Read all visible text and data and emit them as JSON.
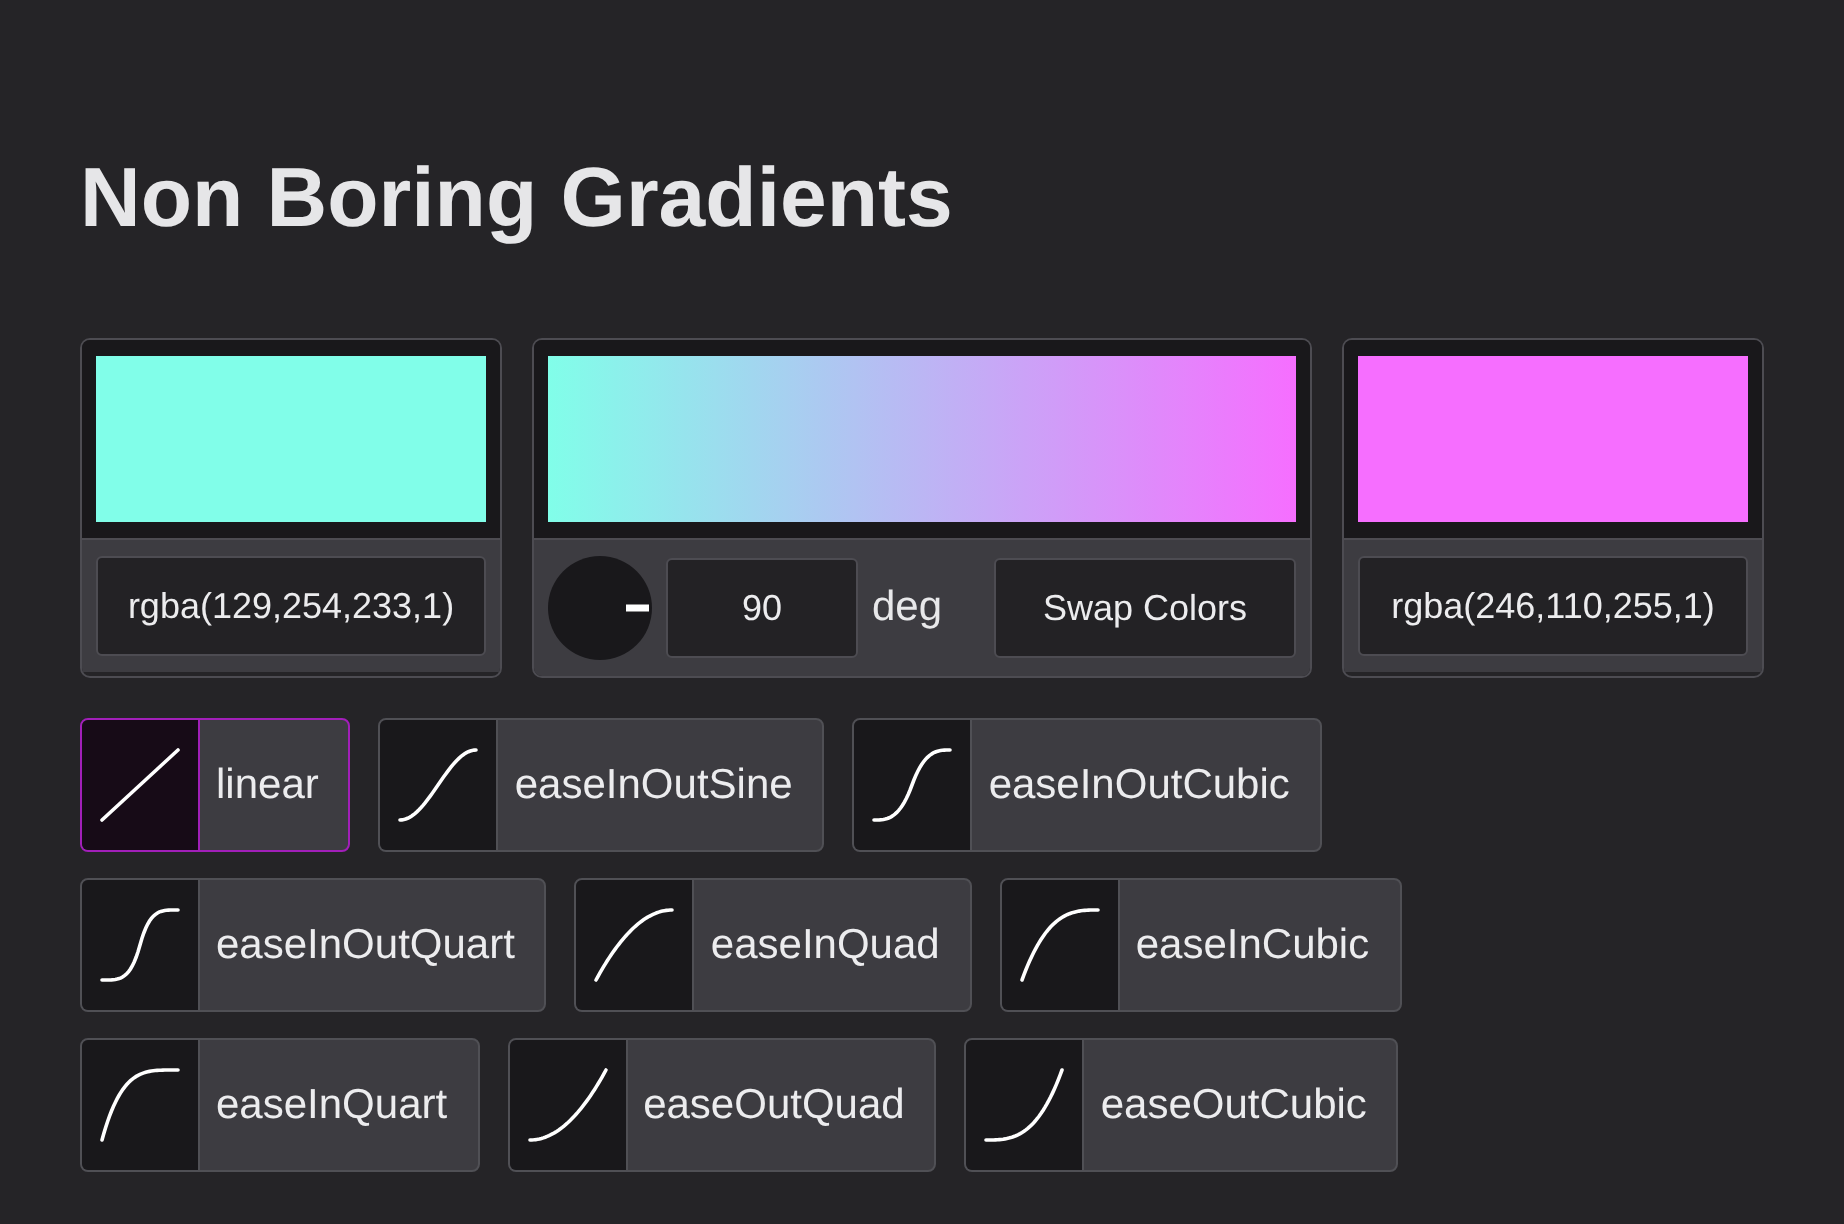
{
  "title": "Non Boring Gradients",
  "stops": [
    {
      "value": "rgba(129,254,233,1)",
      "color": "#81fee9"
    },
    {
      "value": "rgba(246,110,255,1)",
      "color": "#f66eff"
    }
  ],
  "angle": {
    "value": "90",
    "unit": "deg"
  },
  "swap_button": "Swap Colors",
  "easings": [
    {
      "label": "linear",
      "kind": "linear",
      "selected": true
    },
    {
      "label": "easeInOutSine",
      "kind": "inOutSine",
      "selected": false
    },
    {
      "label": "easeInOutCubic",
      "kind": "inOutCubic",
      "selected": false
    },
    {
      "label": "easeInOutQuart",
      "kind": "inOutQuart",
      "selected": false
    },
    {
      "label": "easeInQuad",
      "kind": "inQuad",
      "selected": false
    },
    {
      "label": "easeInCubic",
      "kind": "inCubic",
      "selected": false
    },
    {
      "label": "easeInQuart",
      "kind": "inQuart",
      "selected": false
    },
    {
      "label": "easeOutQuad",
      "kind": "outQuad",
      "selected": false
    },
    {
      "label": "easeOutCubic",
      "kind": "outCubic",
      "selected": false
    }
  ]
}
